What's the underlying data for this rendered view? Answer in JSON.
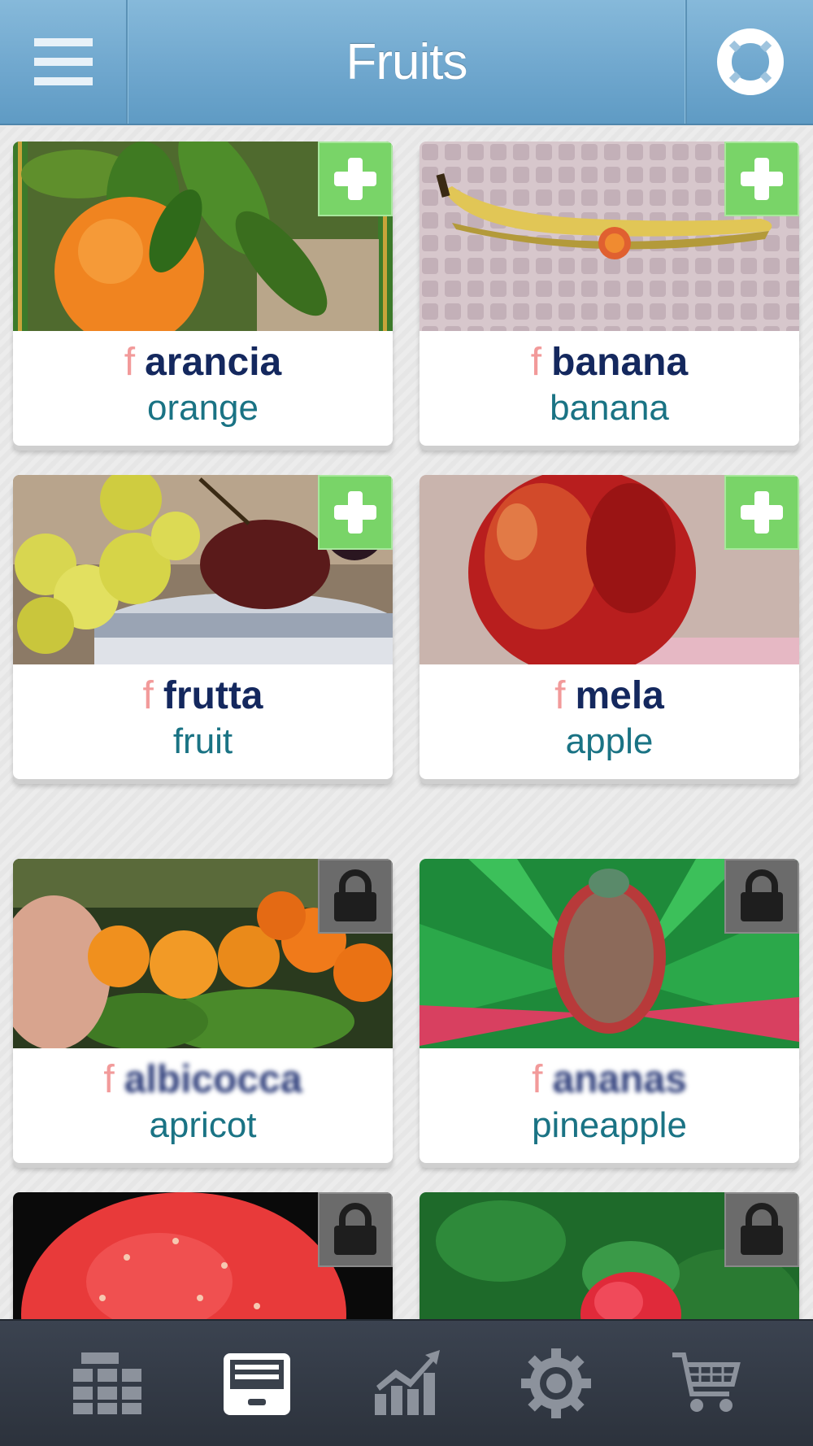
{
  "header": {
    "title": "Fruits",
    "menu_icon": "hamburger-menu-icon",
    "help_icon": "lifebuoy-icon",
    "background_color": "#6ea6cd"
  },
  "cards": [
    {
      "gender": "f",
      "word": "arancia",
      "translation": "orange",
      "status": "add",
      "image": "orange-photo"
    },
    {
      "gender": "f",
      "word": "banana",
      "translation": "banana",
      "status": "add",
      "image": "banana-photo"
    },
    {
      "gender": "f",
      "word": "frutta",
      "translation": "fruit",
      "status": "add",
      "image": "fruit-bowl-photo"
    },
    {
      "gender": "f",
      "word": "mela",
      "translation": "apple",
      "status": "add",
      "image": "apple-photo"
    },
    {
      "gender": "f",
      "word": "albicocca",
      "translation": "apricot",
      "status": "locked",
      "image": "apricot-photo"
    },
    {
      "gender": "f",
      "word": "ananas",
      "translation": "pineapple",
      "status": "locked",
      "image": "pineapple-photo"
    },
    {
      "gender": "",
      "word": "",
      "translation": "",
      "status": "locked",
      "image": "watermelon-photo"
    },
    {
      "gender": "",
      "word": "",
      "translation": "",
      "status": "locked",
      "image": "raspberry-photo"
    }
  ],
  "tabbar": {
    "tabs": [
      {
        "icon": "grid-icon",
        "active": false
      },
      {
        "icon": "card-box-icon",
        "active": true
      },
      {
        "icon": "chart-icon",
        "active": false
      },
      {
        "icon": "gear-icon",
        "active": false
      },
      {
        "icon": "cart-icon",
        "active": false
      }
    ]
  },
  "colors": {
    "add_badge": "#79d468",
    "lock_badge": "#6b6b6b",
    "gender_marker": "#f29a9a",
    "word": "#14285e",
    "translation": "#1a7384",
    "tabbar": "#2c323c"
  }
}
